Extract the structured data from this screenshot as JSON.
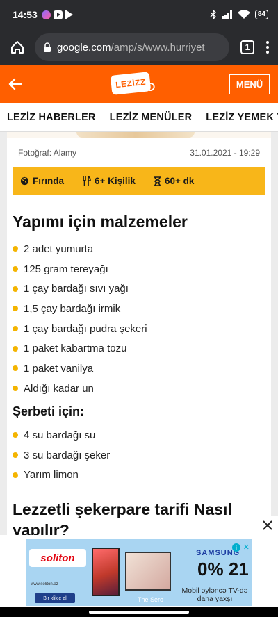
{
  "status_bar": {
    "time": "14:53",
    "battery": "84"
  },
  "browser": {
    "url_host": "google.com",
    "url_path": "/amp/s/www.hurriyet",
    "tab_count": "1"
  },
  "site": {
    "logo_text": "LEZİZZ",
    "menu_label": "MENÜ"
  },
  "categories": [
    "LEZİZ HABERLER",
    "LEZİZ MENÜLER",
    "LEZİZ YEMEK TARİFLERİ"
  ],
  "article": {
    "photo_credit": "Fotoğraf: Alamy",
    "date": "31.01.2021 - 19:29",
    "info": {
      "method": "Fırında",
      "servings": "6+ Kişilik",
      "time": "60+ dk"
    },
    "ingredients_title": "Yapımı için malzemeler",
    "ingredients": [
      "2 adet yumurta",
      "125 gram tereyağı",
      "1 çay bardağı sıvı yağı",
      "1,5 çay bardağı irmik",
      "1 çay bardağı pudra şekeri",
      "1 paket kabartma tozu",
      "1 paket vanilya",
      "Aldığı kadar un"
    ],
    "syrup_title": "Şerbeti için:",
    "syrup": [
      "4 su bardağı su",
      "3 su bardağı şeker",
      "Yarım limon"
    ],
    "method_title": "Lezzetli şekerpare tarifi Nasıl yapılır?"
  },
  "ad": {
    "brand": "soliton",
    "url": "www.soliton.az",
    "cta": "Bir klikle al",
    "product_name": "The Sero",
    "samsung": "SAMSUNG",
    "rate": "0% 21",
    "promo": "Mobil əyləncə TV-də daha yaxşı"
  },
  "colors": {
    "brand_orange": "#ff5f00",
    "info_yellow": "#f8b619",
    "bullet": "#f4b400"
  }
}
